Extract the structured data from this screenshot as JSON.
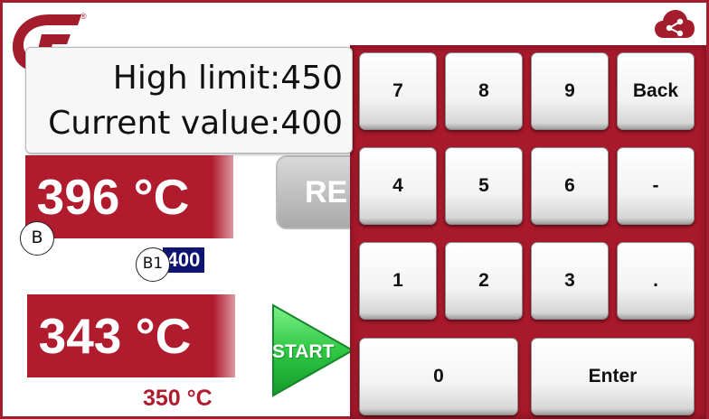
{
  "brand": {
    "registered_mark": "®",
    "accent_color": "#a31d2c"
  },
  "header": {
    "share_icon": "cloud-share-icon"
  },
  "info_panel": {
    "line1": "High limit:450",
    "line2": "Current value:400"
  },
  "zone1": {
    "temperature": "396 °C",
    "setpoint": "400",
    "callout": "B",
    "setpoint_callout": "B1"
  },
  "zone2": {
    "temperature": "343 °C",
    "setpoint": "350 °C"
  },
  "buttons": {
    "reset_label": "RE",
    "start_label": "START"
  },
  "keypad": {
    "keys": [
      "7",
      "8",
      "9",
      "Back",
      "4",
      "5",
      "6",
      "-",
      "1",
      "2",
      "3",
      ".",
      "0",
      "Enter"
    ]
  }
}
